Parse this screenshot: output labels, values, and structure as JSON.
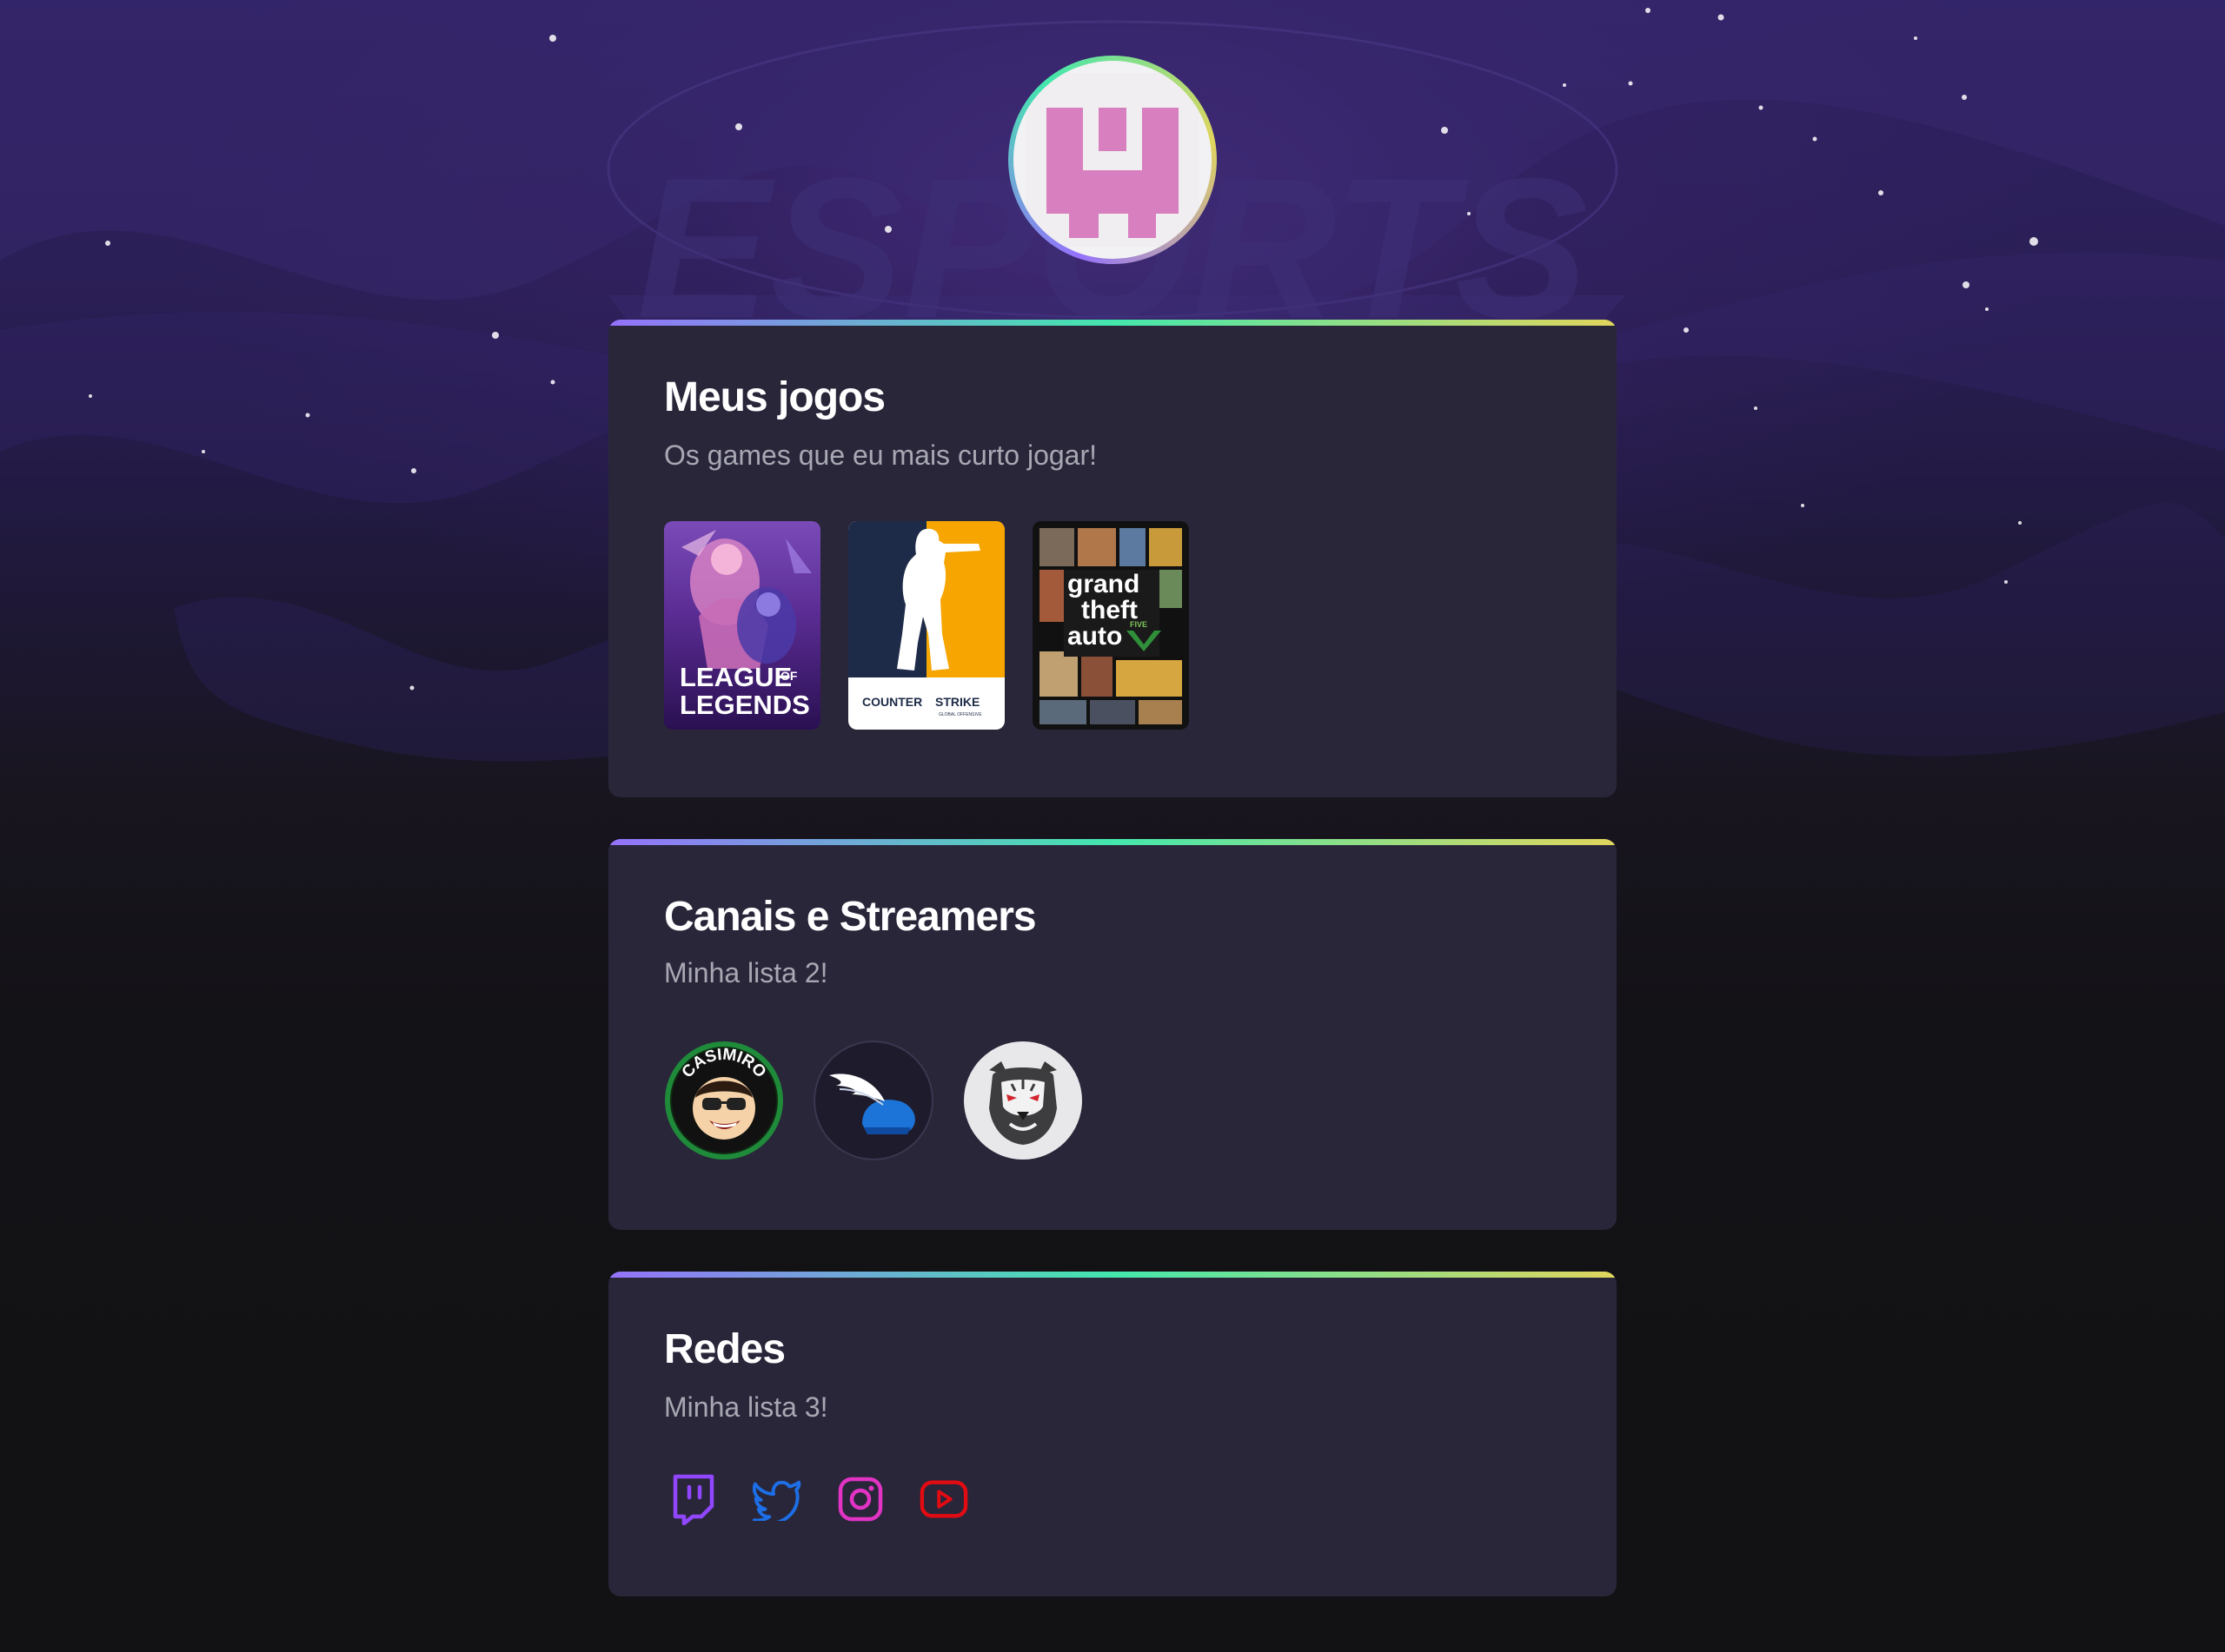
{
  "background": {
    "watermark_text": "ESPORTS"
  },
  "avatar": {
    "icon": "pink-w-logo-icon",
    "ring_colors": [
      "#9572fc",
      "#43e7ad",
      "#e1d55d"
    ]
  },
  "games_card": {
    "title": "Meus jogos",
    "subtitle": "Os games que eu mais curto jogar!",
    "items": [
      {
        "name": "league-of-legends",
        "label_line1": "LEAGUE",
        "label_of": "OF",
        "label_line2": "LEGENDS"
      },
      {
        "name": "counter-strike",
        "label": "COUNTER",
        "label2": "STRIKE",
        "small": "GLOBAL OFFENSIVE"
      },
      {
        "name": "grand-theft-auto-v",
        "label_line1": "grand",
        "label_line2": "theft",
        "label_line3": "auto",
        "label_five": "FIVE"
      }
    ]
  },
  "streamers_card": {
    "title": "Canais e Streamers",
    "subtitle": "Minha lista 2!",
    "items": [
      {
        "name": "casimiro",
        "badge_text": "CASIMIRO"
      },
      {
        "name": "winged-helmet"
      },
      {
        "name": "tiger"
      }
    ]
  },
  "redes_card": {
    "title": "Redes",
    "subtitle": "Minha lista 3!",
    "items": [
      {
        "name": "twitch-icon",
        "color": "#9146ff"
      },
      {
        "name": "twitter-icon",
        "color": "#1d6fe8"
      },
      {
        "name": "instagram-icon",
        "color": "#e233c4"
      },
      {
        "name": "youtube-icon",
        "color": "#e30b12"
      }
    ]
  },
  "colors": {
    "card_bg": "#29263a",
    "title": "#ffffff",
    "subtitle": "#a8a8b3",
    "gradient": [
      "#9572fc",
      "#43e7ad",
      "#e1d55d"
    ]
  }
}
